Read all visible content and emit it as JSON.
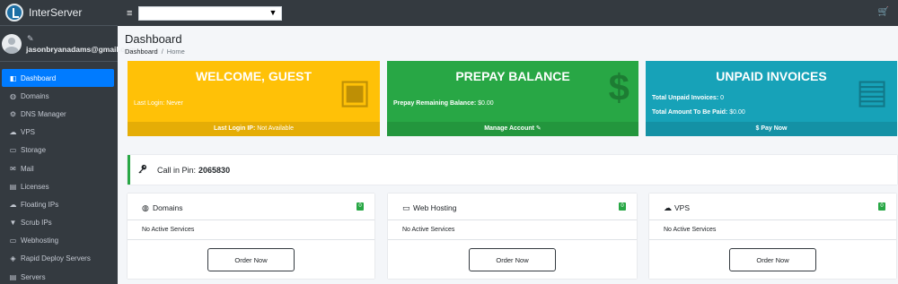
{
  "brand": {
    "name": "InterServer"
  },
  "user": {
    "email": "jasonbryanadams@gmail.com",
    "edit_icon": "pencil-icon"
  },
  "sidebar": {
    "items": [
      {
        "label": "Dashboard",
        "icon": "dashboard-icon",
        "glyph": "◧",
        "active": true
      },
      {
        "label": "Domains",
        "icon": "globe-icon",
        "glyph": "◍"
      },
      {
        "label": "DNS Manager",
        "icon": "wrench-icon",
        "glyph": "⚙"
      },
      {
        "label": "VPS",
        "icon": "cloud-icon",
        "glyph": "☁"
      },
      {
        "label": "Storage",
        "icon": "storage-icon",
        "glyph": "▭"
      },
      {
        "label": "Mail",
        "icon": "envelope-icon",
        "glyph": "✉"
      },
      {
        "label": "Licenses",
        "icon": "license-icon",
        "glyph": "▤"
      },
      {
        "label": "Floating IPs",
        "icon": "cloud-ip-icon",
        "glyph": "☁"
      },
      {
        "label": "Scrub IPs",
        "icon": "filter-icon",
        "glyph": "▼"
      },
      {
        "label": "Webhosting",
        "icon": "window-icon",
        "glyph": "▭"
      },
      {
        "label": "Rapid Deploy Servers",
        "icon": "rocket-icon",
        "glyph": "◈"
      },
      {
        "label": "Servers",
        "icon": "server-icon",
        "glyph": "▤"
      }
    ]
  },
  "topbar": {
    "hamburger_glyph": "≡",
    "select_value": "",
    "caret_glyph": "▼",
    "cart_glyph": "🛒"
  },
  "page": {
    "title": "Dashboard",
    "breadcrumb": [
      "Dashboard",
      "Home"
    ],
    "breadcrumb_sep": "/"
  },
  "boxes": {
    "welcome": {
      "title": "WELCOME, GUEST",
      "line1": "Last Login: Never",
      "footer_label": "Last Login IP:",
      "footer_value": "Not Available",
      "icon": "id-card-icon",
      "glyph": "▣",
      "color": "#ffc107"
    },
    "prepay": {
      "title": "PREPAY BALANCE",
      "line1": "Prepay Remaining Balance:",
      "line1_value": "$0.00",
      "footer": "Manage Account",
      "footer_glyph": "✎",
      "icon": "dollar-icon",
      "glyph": "$",
      "color": "#28a745"
    },
    "invoices": {
      "title": "UNPAID INVOICES",
      "line1": "Total Unpaid Invoices:",
      "line1_value": "0",
      "line2": "Total Amount To Be Paid:",
      "line2_value": "$0.00",
      "footer": "$ Pay Now",
      "icon": "document-icon",
      "glyph": "▤",
      "color": "#17a2b8"
    }
  },
  "pin": {
    "label": "Call in Pin:",
    "value": "2065830",
    "icon": "key-icon",
    "glyph": "🔑",
    "accent": "#28a745"
  },
  "services": [
    {
      "name": "Domains",
      "icon": "globe-icon",
      "glyph": "◍",
      "badge": "0",
      "status": "No Active Services",
      "button": "Order Now"
    },
    {
      "name": "Web Hosting",
      "icon": "window-icon",
      "glyph": "▭",
      "badge": "0",
      "status": "No Active Services",
      "button": "Order Now"
    },
    {
      "name": "VPS",
      "icon": "cloud-icon",
      "glyph": "☁",
      "badge": "0",
      "status": "No Active Services",
      "button": "Order Now"
    }
  ]
}
